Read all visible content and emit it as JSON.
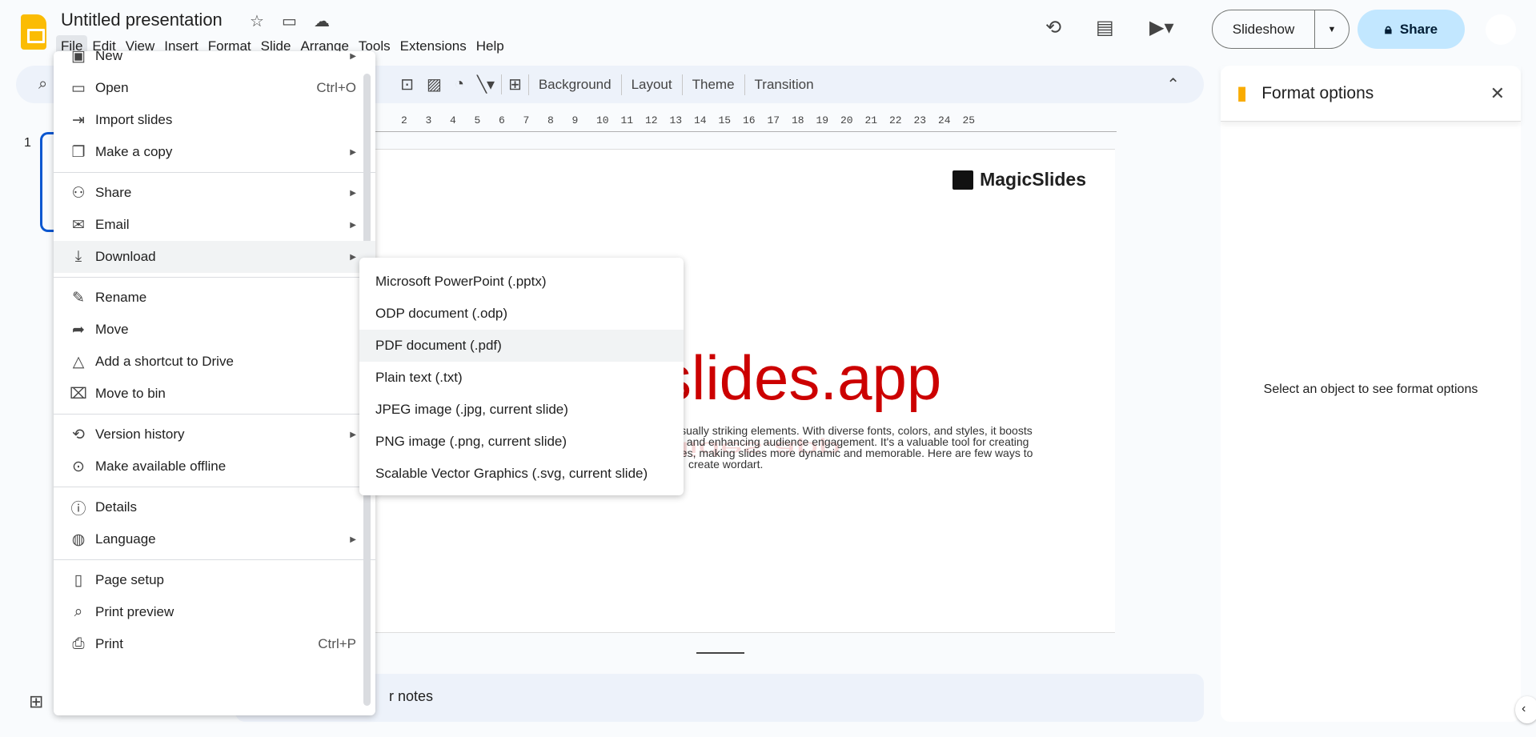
{
  "doc": {
    "title": "Untitled presentation"
  },
  "menubar": [
    "File",
    "Edit",
    "View",
    "Insert",
    "Format",
    "Slide",
    "Arrange",
    "Tools",
    "Extensions",
    "Help"
  ],
  "header": {
    "slideshow": "Slideshow",
    "share": "Share"
  },
  "toolbar": {
    "background": "Background",
    "layout": "Layout",
    "theme": "Theme",
    "transition": "Transition"
  },
  "ruler": [
    "2",
    "3",
    "4",
    "5",
    "6",
    "7",
    "8",
    "9",
    "10",
    "11",
    "12",
    "13",
    "14",
    "15",
    "16",
    "17",
    "18",
    "19",
    "20",
    "21",
    "22",
    "23",
    "24",
    "25"
  ],
  "thumbnails": {
    "number": "1"
  },
  "slide": {
    "brand": "MagicSlides",
    "headline": "slides.app",
    "para": [
      "visually striking elements. With diverse fonts, colors, and styles, it boosts",
      "s, and enhancing audience engagement. It's a valuable tool for creating",
      "ges, making slides more dynamic and memorable. Here are few ways to",
      "create wordart."
    ]
  },
  "notes": "r notes",
  "panel": {
    "title": "Format options",
    "hint": "Select an object to see format options"
  },
  "file_menu": [
    {
      "icon": "▣",
      "name": "new",
      "label": "New",
      "arrow": true
    },
    {
      "icon": "▭",
      "name": "open",
      "label": "Open",
      "shortcut": "Ctrl+O"
    },
    {
      "icon": "⇥",
      "name": "import",
      "label": "Import slides"
    },
    {
      "icon": "❐",
      "name": "copy",
      "label": "Make a copy",
      "arrow": true
    },
    {
      "sep": true
    },
    {
      "icon": "⚇",
      "name": "share",
      "label": "Share",
      "arrow": true
    },
    {
      "icon": "✉",
      "name": "email",
      "label": "Email",
      "arrow": true
    },
    {
      "icon": "⤓",
      "name": "download",
      "label": "Download",
      "arrow": true,
      "hl": true
    },
    {
      "sep": true
    },
    {
      "icon": "✎",
      "name": "rename",
      "label": "Rename"
    },
    {
      "icon": "➦",
      "name": "move",
      "label": "Move"
    },
    {
      "icon": "△",
      "name": "shortcut",
      "label": "Add a shortcut to Drive"
    },
    {
      "icon": "⌧",
      "name": "trash",
      "label": "Move to bin"
    },
    {
      "sep": true
    },
    {
      "icon": "⟲",
      "name": "history",
      "label": "Version history",
      "arrow": true
    },
    {
      "icon": "⊙",
      "name": "offline",
      "label": "Make available offline"
    },
    {
      "sep": true
    },
    {
      "icon": "ⓘ",
      "name": "details",
      "label": "Details"
    },
    {
      "icon": "◍",
      "name": "globe",
      "label": "Language",
      "arrow": true
    },
    {
      "sep": true
    },
    {
      "icon": "▯",
      "name": "page-setup",
      "label": "Page setup"
    },
    {
      "icon": "⌕",
      "name": "print-preview",
      "label": "Print preview"
    },
    {
      "icon": "⎙",
      "name": "print",
      "label": "Print",
      "shortcut": "Ctrl+P"
    }
  ],
  "download_menu": [
    "Microsoft PowerPoint (.pptx)",
    "ODP document (.odp)",
    "PDF document (.pdf)",
    "Plain text (.txt)",
    "JPEG image (.jpg, current slide)",
    "PNG image (.png, current slide)",
    "Scalable Vector Graphics (.svg, current slide)"
  ],
  "download_highlight": 2
}
